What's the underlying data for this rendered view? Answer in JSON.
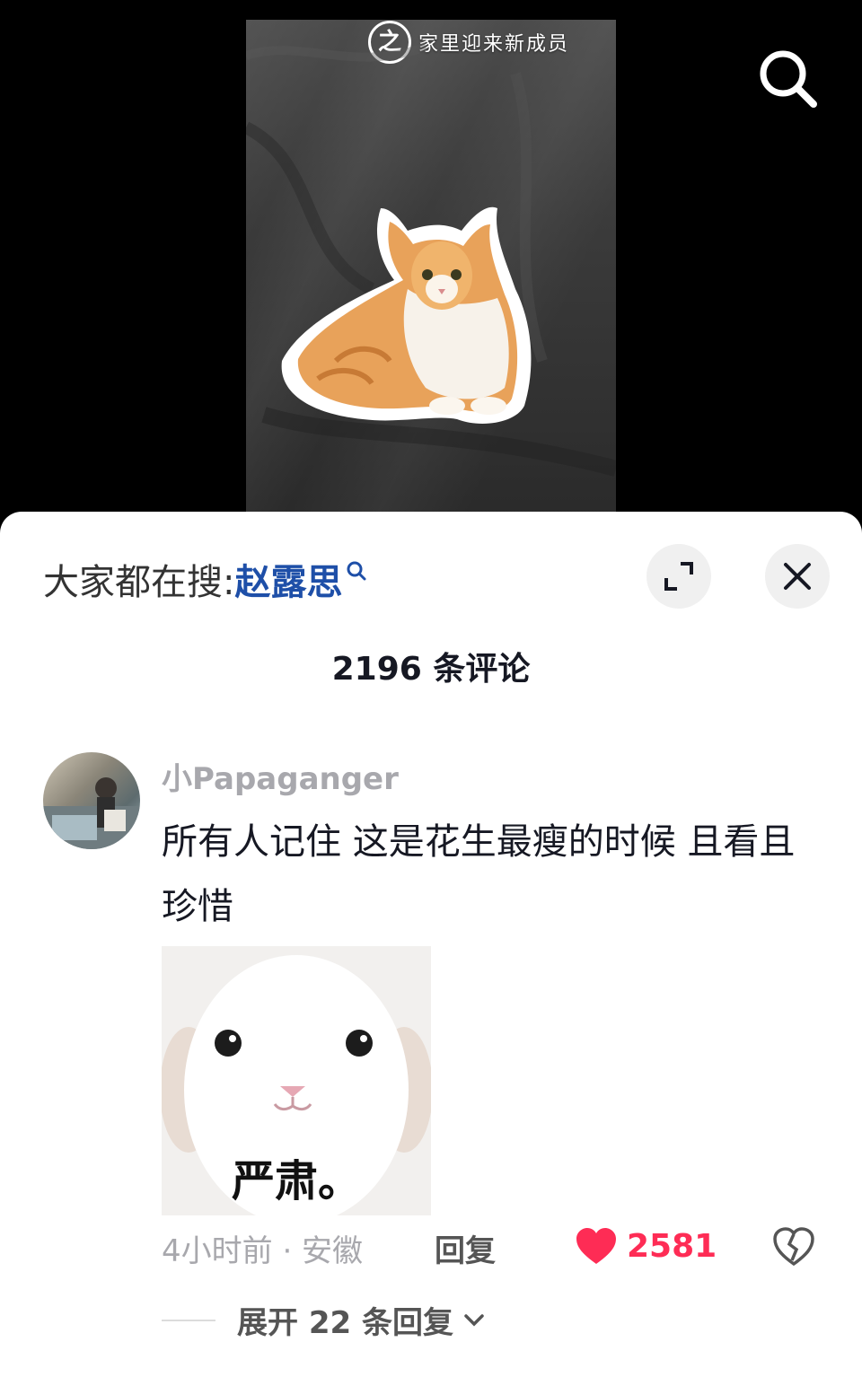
{
  "video": {
    "watermark_logo": "之",
    "watermark_text": "家里迎来新成员"
  },
  "sheet": {
    "trending_prefix": "大家都在搜:",
    "trending_keyword": "赵露思",
    "comment_count_title": "2196 条评论"
  },
  "comment": {
    "username": "小Papaganger",
    "text": "所有人记住 这是花生最瘦的时候 且看且珍惜",
    "sticker_caption": "严肃。",
    "meta": "4小时前 · 安徽",
    "reply_label": "回复",
    "like_count": "2581",
    "expand_label": "展开 22 条回复"
  },
  "colors": {
    "accent": "#fe2c55",
    "keyword": "#1e4fa8"
  },
  "icons": [
    "search-icon",
    "expand-icon",
    "close-icon",
    "heart-icon",
    "dislike-icon",
    "chevron-down-icon"
  ]
}
